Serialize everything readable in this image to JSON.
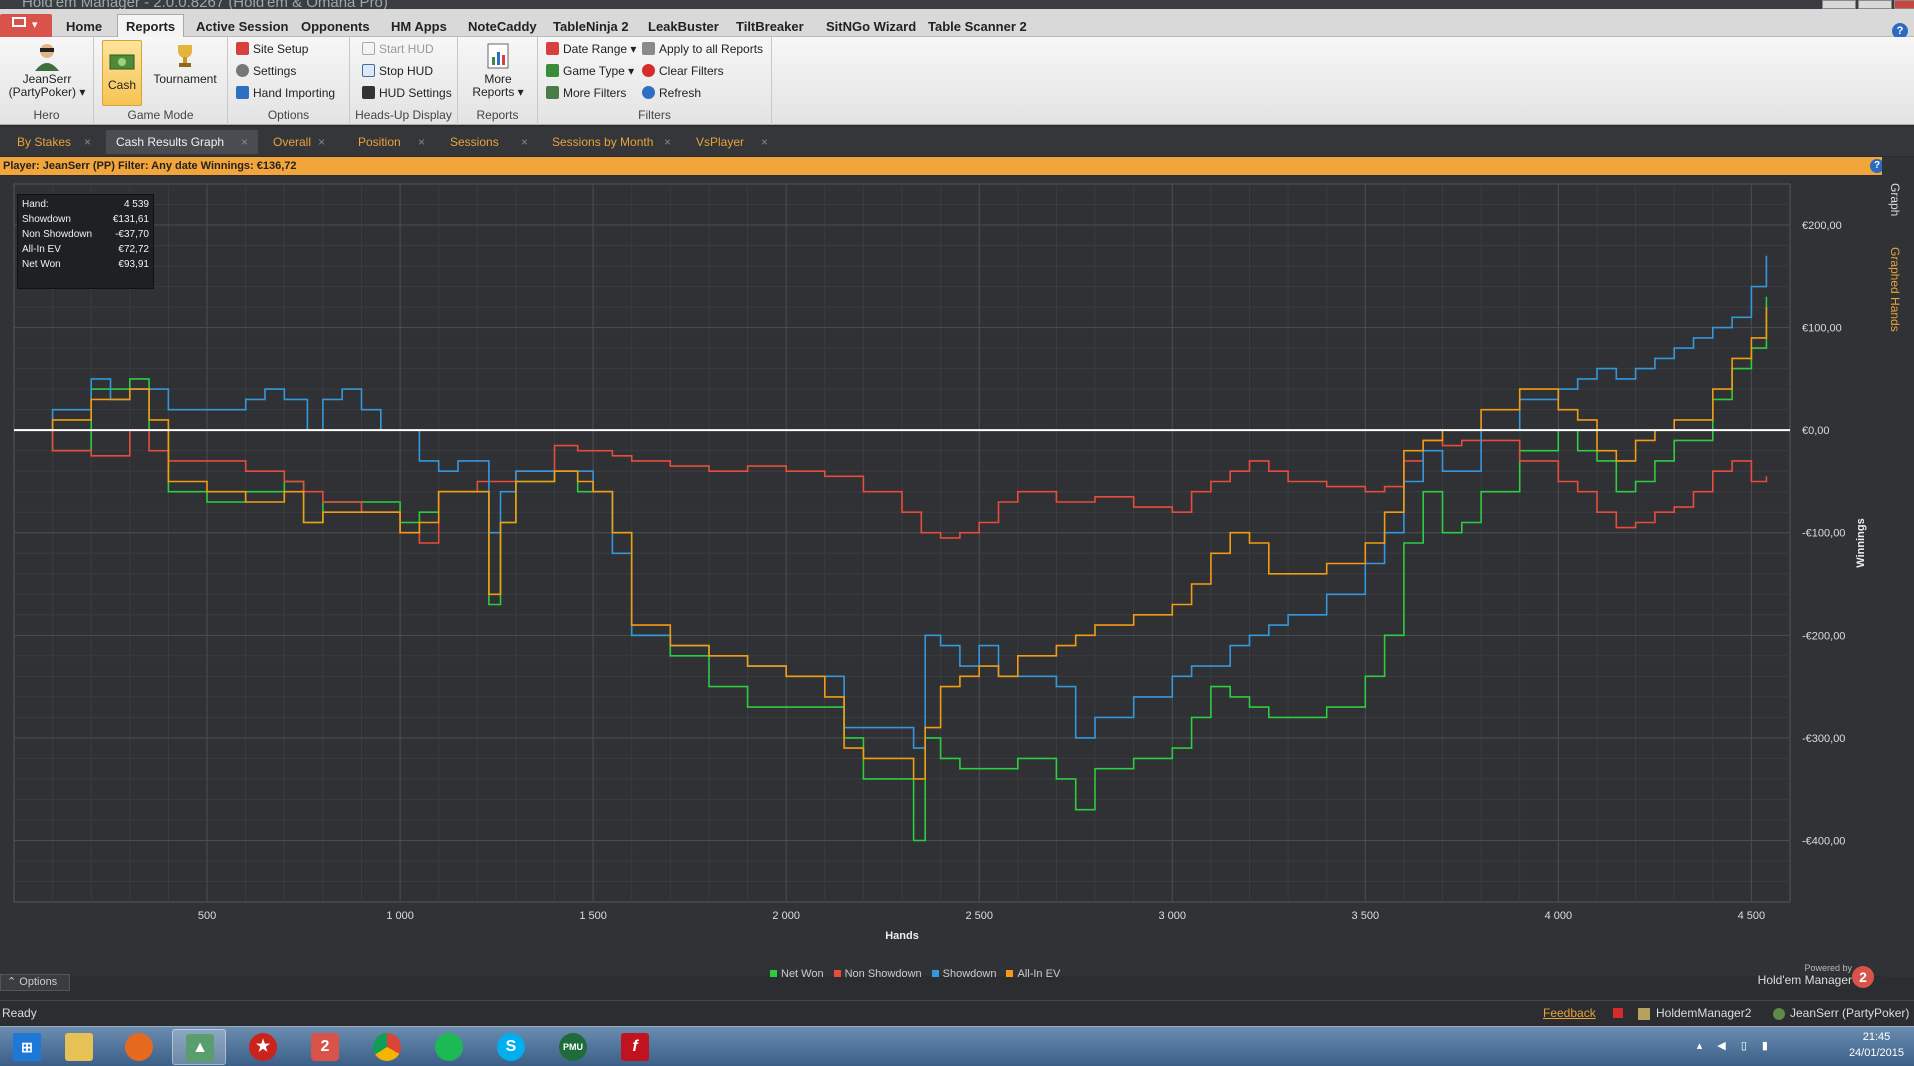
{
  "window": {
    "title": "Hold'em Manager - 2.0.0.8267 (Hold'em & Omaha Pro)"
  },
  "menu": {
    "tabs": [
      "Home",
      "Reports",
      "Active Session",
      "Opponents",
      "HM Apps",
      "NoteCaddy",
      "TableNinja 2",
      "LeakBuster",
      "TiltBreaker",
      "SitNGo Wizard",
      "Table Scanner 2"
    ],
    "active": "Reports"
  },
  "ribbon": {
    "hero": {
      "name": "JeanSerr",
      "site": "(PartyPoker) ▾",
      "label": "Hero"
    },
    "game_mode": {
      "cash": "Cash",
      "tournament": "Tournament",
      "label": "Game Mode"
    },
    "options": {
      "items": [
        "Site Setup",
        "Settings",
        "Hand Importing"
      ],
      "label": "Options"
    },
    "hud": {
      "items": [
        "Start HUD",
        "Stop HUD",
        "HUD Settings"
      ],
      "label": "Heads-Up Display"
    },
    "reports": {
      "more_line1": "More",
      "more_line2": "Reports ▾",
      "label": "Reports"
    },
    "filters": {
      "date_range": "Date Range ▾",
      "game_type": "Game Type ▾",
      "more_filters": "More Filters",
      "apply_all": "Apply to all Reports",
      "clear": "Clear Filters",
      "refresh": "Refresh",
      "label": "Filters"
    }
  },
  "doc_tabs": [
    {
      "label": "By Stakes",
      "active": false
    },
    {
      "label": "Cash Results Graph",
      "active": true
    },
    {
      "label": "Overall",
      "active": false
    },
    {
      "label": "Position",
      "active": false
    },
    {
      "label": "Sessions",
      "active": false
    },
    {
      "label": "Sessions by Month",
      "active": false
    },
    {
      "label": "VsPlayer",
      "active": false
    }
  ],
  "filter_bar": "Player: JeanSerr (PP)  Filter: Any date  Winnings: €136,72",
  "side_tabs": {
    "graph": "Graph",
    "graphed_hands": "Graphed Hands"
  },
  "stats": [
    {
      "label": "Hand:",
      "value": "4 539"
    },
    {
      "label": "Showdown",
      "value": "€131,61"
    },
    {
      "label": "Non Showdown",
      "value": "-€37,70"
    },
    {
      "label": "All-In EV",
      "value": "€72,72"
    },
    {
      "label": "Net Won",
      "value": "€93,91"
    }
  ],
  "chart_data": {
    "type": "line",
    "xlabel": "Hands",
    "ylabel": "Winnings",
    "xlim": [
      0,
      4600
    ],
    "ylim": [
      -460,
      240
    ],
    "x_ticks": [
      500,
      1000,
      1500,
      2000,
      2500,
      3000,
      3500,
      4000,
      4500
    ],
    "x_tick_labels": [
      "500",
      "1 000",
      "1 500",
      "2 000",
      "2 500",
      "3 000",
      "3 500",
      "4 000",
      "4 500"
    ],
    "y_ticks": [
      200,
      100,
      0,
      -100,
      -200,
      -300,
      -400
    ],
    "y_tick_labels": [
      "€200,00",
      "€100,00",
      "€0,00",
      "-€100,00",
      "-€200,00",
      "-€300,00",
      "-€400,00"
    ],
    "grid": true,
    "legend_position": "bottom-center",
    "series": [
      {
        "name": "Net Won",
        "color": "#2ecc40",
        "x": [
          0,
          100,
          200,
          300,
          350,
          400,
          500,
          600,
          700,
          750,
          800,
          900,
          1000,
          1050,
          1100,
          1200,
          1230,
          1260,
          1300,
          1400,
          1460,
          1500,
          1550,
          1600,
          1700,
          1800,
          1900,
          2000,
          2050,
          2100,
          2150,
          2200,
          2300,
          2330,
          2360,
          2400,
          2450,
          2500,
          2600,
          2700,
          2750,
          2800,
          2900,
          3000,
          3050,
          3100,
          3150,
          3200,
          3250,
          3300,
          3400,
          3500,
          3550,
          3600,
          3650,
          3700,
          3750,
          3800,
          3900,
          4000,
          4050,
          4100,
          4150,
          4200,
          4250,
          4300,
          4400,
          4450,
          4500,
          4539
        ],
        "values": [
          0,
          -20,
          40,
          50,
          0,
          -60,
          -70,
          -60,
          -50,
          -90,
          -70,
          -70,
          -90,
          -80,
          -60,
          -60,
          -170,
          -90,
          -50,
          -40,
          -60,
          -60,
          -100,
          -200,
          -220,
          -250,
          -270,
          -270,
          -270,
          -270,
          -300,
          -340,
          -340,
          -400,
          -300,
          -320,
          -330,
          -330,
          -320,
          -340,
          -370,
          -330,
          -320,
          -310,
          -280,
          -250,
          -260,
          -270,
          -280,
          -280,
          -270,
          -240,
          -200,
          -110,
          -60,
          -100,
          -90,
          -60,
          -20,
          0,
          -20,
          -30,
          -60,
          -50,
          -30,
          -10,
          30,
          60,
          80,
          130
        ]
      },
      {
        "name": "Non Showdown",
        "color": "#e74c3c",
        "x": [
          0,
          100,
          200,
          300,
          350,
          400,
          500,
          600,
          700,
          750,
          800,
          900,
          1000,
          1050,
          1100,
          1200,
          1300,
          1400,
          1460,
          1500,
          1550,
          1600,
          1700,
          1800,
          1900,
          2000,
          2100,
          2200,
          2300,
          2350,
          2400,
          2450,
          2500,
          2550,
          2600,
          2700,
          2800,
          2900,
          3000,
          3050,
          3100,
          3150,
          3200,
          3250,
          3300,
          3400,
          3500,
          3550,
          3600,
          3650,
          3700,
          3750,
          3800,
          3900,
          4000,
          4050,
          4100,
          4150,
          4200,
          4250,
          4300,
          4350,
          4400,
          4450,
          4500,
          4539
        ],
        "values": [
          0,
          -20,
          -25,
          0,
          -20,
          -30,
          -30,
          -40,
          -50,
          -60,
          -70,
          -80,
          -100,
          -110,
          -60,
          -50,
          -40,
          -15,
          -20,
          -20,
          -25,
          -30,
          -35,
          -40,
          -35,
          -40,
          -45,
          -60,
          -80,
          -100,
          -105,
          -100,
          -90,
          -70,
          -60,
          -70,
          -65,
          -75,
          -80,
          -60,
          -50,
          -40,
          -30,
          -40,
          -50,
          -55,
          -60,
          -55,
          -30,
          -10,
          -15,
          -10,
          -10,
          -30,
          -50,
          -60,
          -80,
          -95,
          -90,
          -80,
          -75,
          -60,
          -40,
          -30,
          -50,
          -45
        ]
      },
      {
        "name": "Showdown",
        "color": "#3498db",
        "x": [
          0,
          100,
          200,
          250,
          300,
          400,
          500,
          600,
          650,
          700,
          760,
          800,
          850,
          900,
          950,
          1000,
          1050,
          1100,
          1150,
          1200,
          1230,
          1260,
          1300,
          1400,
          1460,
          1500,
          1550,
          1600,
          1700,
          1800,
          1900,
          2000,
          2050,
          2100,
          2150,
          2200,
          2300,
          2330,
          2360,
          2400,
          2450,
          2500,
          2550,
          2600,
          2700,
          2750,
          2800,
          2900,
          3000,
          3050,
          3100,
          3150,
          3200,
          3250,
          3300,
          3400,
          3500,
          3550,
          3600,
          3650,
          3700,
          3750,
          3800,
          3900,
          4000,
          4050,
          4100,
          4150,
          4200,
          4250,
          4300,
          4350,
          4400,
          4450,
          4500,
          4539
        ],
        "values": [
          0,
          20,
          50,
          30,
          40,
          20,
          20,
          30,
          40,
          30,
          0,
          30,
          40,
          20,
          0,
          0,
          -30,
          -40,
          -30,
          -30,
          -100,
          -60,
          -40,
          -40,
          -40,
          -60,
          -120,
          -200,
          -210,
          -220,
          -230,
          -240,
          -240,
          -240,
          -290,
          -290,
          -290,
          -310,
          -200,
          -210,
          -230,
          -210,
          -240,
          -240,
          -250,
          -300,
          -280,
          -260,
          -240,
          -230,
          -230,
          -210,
          -200,
          -190,
          -180,
          -160,
          -130,
          -100,
          -50,
          -20,
          -40,
          -40,
          0,
          30,
          40,
          50,
          60,
          50,
          60,
          70,
          80,
          90,
          100,
          110,
          140,
          170
        ]
      },
      {
        "name": "All-In EV",
        "color": "#f39c12",
        "x": [
          0,
          100,
          200,
          300,
          350,
          400,
          500,
          600,
          700,
          750,
          800,
          900,
          1000,
          1050,
          1100,
          1200,
          1230,
          1260,
          1300,
          1400,
          1460,
          1500,
          1550,
          1600,
          1700,
          1800,
          1900,
          2000,
          2050,
          2100,
          2150,
          2200,
          2300,
          2330,
          2360,
          2400,
          2450,
          2500,
          2550,
          2600,
          2700,
          2750,
          2800,
          2900,
          3000,
          3050,
          3100,
          3150,
          3200,
          3250,
          3300,
          3400,
          3500,
          3550,
          3600,
          3650,
          3700,
          3750,
          3800,
          3900,
          4000,
          4050,
          4100,
          4150,
          4200,
          4250,
          4300,
          4400,
          4450,
          4500,
          4539
        ],
        "values": [
          0,
          10,
          30,
          40,
          10,
          -50,
          -60,
          -70,
          -60,
          -90,
          -80,
          -80,
          -100,
          -90,
          -60,
          -60,
          -160,
          -90,
          -50,
          -40,
          -50,
          -60,
          -100,
          -190,
          -210,
          -220,
          -230,
          -240,
          -240,
          -260,
          -310,
          -320,
          -320,
          -340,
          -290,
          -250,
          -240,
          -230,
          -240,
          -220,
          -210,
          -200,
          -190,
          -180,
          -170,
          -150,
          -120,
          -100,
          -110,
          -140,
          -140,
          -130,
          -110,
          -80,
          -20,
          -10,
          0,
          0,
          20,
          40,
          20,
          10,
          -20,
          -30,
          -10,
          0,
          10,
          40,
          70,
          90,
          120
        ]
      }
    ]
  }
}
